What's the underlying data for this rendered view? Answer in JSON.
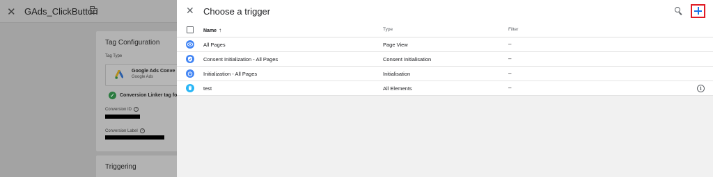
{
  "background": {
    "header": {
      "close_icon": "close-icon",
      "title": "GAds_ClickButton",
      "folder_icon": "folder-icon"
    },
    "tag_configuration": {
      "title": "Tag Configuration",
      "tag_type_label": "Tag Type",
      "tag_name": "Google Ads Conve",
      "tag_vendor": "Google Ads",
      "linker_text": "Conversion Linker tag fo",
      "conversion_id_label": "Conversion ID",
      "conversion_label_label": "Conversion Label"
    },
    "triggering": {
      "title": "Triggering"
    }
  },
  "panel": {
    "title": "Choose a trigger",
    "close_icon": "close-icon",
    "search_icon": "search-icon",
    "add_icon": "plus-icon",
    "columns": {
      "name": "Name",
      "type": "Type",
      "filter": "Filter"
    },
    "rows": [
      {
        "name": "All Pages",
        "type": "Page View",
        "filter": "–",
        "icon": "eye-icon",
        "color": "#4285f4"
      },
      {
        "name": "Consent Initialization - All Pages",
        "type": "Consent Initialisation",
        "filter": "–",
        "icon": "consent-icon",
        "color": "#4285f4"
      },
      {
        "name": "Initialization - All Pages",
        "type": "Initialisation",
        "filter": "–",
        "icon": "power-icon",
        "color": "#4285f4"
      },
      {
        "name": "test",
        "type": "All Elements",
        "filter": "–",
        "icon": "click-icon",
        "color": "#29b6f6",
        "has_info": true
      }
    ]
  },
  "colors": {
    "accent": "#1a73e8",
    "highlight": "#e01b24"
  }
}
